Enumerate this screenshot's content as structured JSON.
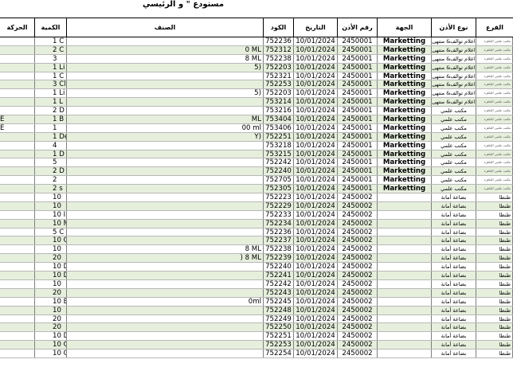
{
  "title": "مستودع \" و الرئيسي",
  "headers": {
    "branch": "الفرع",
    "perm_type": "نوع الأذن",
    "entity": "الجهة",
    "perm_no": "رقم الأذن",
    "date": "التاريخ",
    "code": "الكود",
    "item": "الصنف",
    "qty": "الكمية",
    "movement": "الحركة"
  },
  "rows": [
    {
      "branch": "مكتب علمي القاهرة",
      "ptype": "اعلام توالف& منتهى",
      "entity": "Marketting",
      "no": "2450001",
      "date": "10/01/2024",
      "code": "752236",
      "item": "",
      "qty": "1",
      "qtyx": "C",
      "mv": ""
    },
    {
      "branch": "مكتب علمي القاهرة",
      "ptype": "اعلام توالف& منتهى",
      "entity": "Marketting",
      "no": "2450001",
      "date": "10/01/2024",
      "code": "752312",
      "item": "0 ML",
      "qty": "2",
      "qtyx": "C",
      "mv": ""
    },
    {
      "branch": "مكتب علمي القاهرة",
      "ptype": "اعلام توالف& منتهى",
      "entity": "Marketting",
      "no": "2450001",
      "date": "10/01/2024",
      "code": "752238",
      "item": "8 ML",
      "qty": "3",
      "qtyx": "",
      "mv": ""
    },
    {
      "branch": "مكتب علمي القاهرة",
      "ptype": "اعلام توالف& منتهى",
      "entity": "Marketting",
      "no": "2450001",
      "date": "10/01/2024",
      "code": "752203",
      "item": "5)",
      "qty": "1",
      "qtyx": "Li",
      "mv": ""
    },
    {
      "branch": "مكتب علمي القاهرة",
      "ptype": "اعلام توالف& منتهى",
      "entity": "Marketting",
      "no": "2450001",
      "date": "10/01/2024",
      "code": "752321",
      "item": "",
      "qty": "1",
      "qtyx": "C",
      "mv": ""
    },
    {
      "branch": "مكتب علمي القاهرة",
      "ptype": "اعلام توالف& منتهى",
      "entity": "Marketting",
      "no": "2450001",
      "date": "10/01/2024",
      "code": "752253",
      "item": "",
      "qty": "3",
      "qtyx": "Cle",
      "mv": ""
    },
    {
      "branch": "مكتب علمي القاهرة",
      "ptype": "اعلام توالف& منتهى",
      "entity": "Marketting",
      "no": "2450001",
      "date": "10/01/2024",
      "code": "752203",
      "item": "5)",
      "qty": "1",
      "qtyx": "Li",
      "mv": ""
    },
    {
      "branch": "مكتب علمي القاهرة",
      "ptype": "اعلام توالف& منتهى",
      "entity": "Marketting",
      "no": "2450001",
      "date": "10/01/2024",
      "code": "753214",
      "item": "",
      "qty": "1",
      "qtyx": "L",
      "mv": ""
    },
    {
      "branch": "مكتب علمي القاهرة",
      "ptype": "مكتب علمي",
      "entity": "Marketting",
      "no": "2450001",
      "date": "10/01/2024",
      "code": "753216",
      "item": "",
      "qty": "2",
      "qtyx": "D",
      "mv": ""
    },
    {
      "branch": "مكتب علمي القاهرة",
      "ptype": "مكتب علمي",
      "entity": "Marketting",
      "no": "2450001",
      "date": "10/01/2024",
      "code": "753404",
      "item": "ML",
      "qty": "1",
      "qtyx": "B",
      "mv": "E"
    },
    {
      "branch": "مكتب علمي القاهرة",
      "ptype": "مكتب علمي",
      "entity": "Marketting",
      "no": "2450001",
      "date": "10/01/2024",
      "code": "753406",
      "item": "00 ml",
      "qty": "1",
      "qtyx": "",
      "mv": "E"
    },
    {
      "branch": "مكتب علمي القاهرة",
      "ptype": "مكتب علمي",
      "entity": "Marketting",
      "no": "2450001",
      "date": "10/01/2024",
      "code": "752251",
      "item": "Y)",
      "qty": "1",
      "qtyx": "De",
      "mv": ""
    },
    {
      "branch": "مكتب علمي القاهرة",
      "ptype": "مكتب علمي",
      "entity": "Marketting",
      "no": "2450001",
      "date": "10/01/2024",
      "code": "753218",
      "item": "",
      "qty": "4",
      "qtyx": "",
      "mv": ""
    },
    {
      "branch": "مكتب علمي القاهرة",
      "ptype": "مكتب علمي",
      "entity": "Marketting",
      "no": "2450001",
      "date": "10/01/2024",
      "code": "753215",
      "item": "",
      "qty": "1",
      "qtyx": "D",
      "mv": ""
    },
    {
      "branch": "مكتب علمي القاهرة",
      "ptype": "مكتب علمي",
      "entity": "Marketting",
      "no": "2450001",
      "date": "10/01/2024",
      "code": "752242",
      "item": "",
      "qty": "5",
      "qtyx": "",
      "mv": ""
    },
    {
      "branch": "مكتب علمي القاهرة",
      "ptype": "مكتب علمي",
      "entity": "Marketting",
      "no": "2450001",
      "date": "10/01/2024",
      "code": "752240",
      "item": "",
      "qty": "2",
      "qtyx": "D",
      "mv": ""
    },
    {
      "branch": "مكتب علمي القاهرة",
      "ptype": "مكتب علمي",
      "entity": "Marketting",
      "no": "2450001",
      "date": "10/01/2024",
      "code": "752705",
      "item": "",
      "qty": "2",
      "qtyx": "",
      "mv": ""
    },
    {
      "branch": "مكتب علمي القاهرة",
      "ptype": "مكتب علمي",
      "entity": "Marketting",
      "no": "2450001",
      "date": "10/01/2024",
      "code": "752305",
      "item": "",
      "qty": "2",
      "qtyx": "s",
      "mv": ""
    },
    {
      "branch": "طنطا",
      "ptype": "بضاعة أمانة",
      "entity": "",
      "no": "2450002",
      "date": "10/01/2024",
      "code": "752223",
      "item": "",
      "qty": "10",
      "qtyx": "",
      "mv": ""
    },
    {
      "branch": "طنطا",
      "ptype": "بضاعة أمانة",
      "entity": "",
      "no": "2450002",
      "date": "10/01/2024",
      "code": "752229",
      "item": "",
      "qty": "10",
      "qtyx": "",
      "mv": ""
    },
    {
      "branch": "طنطا",
      "ptype": "بضاعة أمانة",
      "entity": "",
      "no": "2450002",
      "date": "10/01/2024",
      "code": "752233",
      "item": "",
      "qty": "10",
      "qtyx": "I",
      "mv": ""
    },
    {
      "branch": "طنطا",
      "ptype": "بضاعة أمانة",
      "entity": "",
      "no": "2450002",
      "date": "10/01/2024",
      "code": "752234",
      "item": "",
      "qty": "10",
      "qtyx": "M",
      "mv": ""
    },
    {
      "branch": "طنطا",
      "ptype": "بضاعة أمانة",
      "entity": "",
      "no": "2450002",
      "date": "10/01/2024",
      "code": "752236",
      "item": "",
      "qty": "5",
      "qtyx": "C",
      "mv": ""
    },
    {
      "branch": "طنطا",
      "ptype": "بضاعة أمانة",
      "entity": "",
      "no": "2450002",
      "date": "10/01/2024",
      "code": "752237",
      "item": "",
      "qty": "10",
      "qtyx": "C",
      "mv": ""
    },
    {
      "branch": "طنطا",
      "ptype": "بضاعة أمانة",
      "entity": "",
      "no": "2450002",
      "date": "10/01/2024",
      "code": "752238",
      "item": "8 ML",
      "qty": "10",
      "qtyx": "",
      "mv": ""
    },
    {
      "branch": "طنطا",
      "ptype": "بضاعة أمانة",
      "entity": "",
      "no": "2450002",
      "date": "10/01/2024",
      "code": "752239",
      "item": ") 8 ML",
      "qty": "20",
      "qtyx": "",
      "mv": ""
    },
    {
      "branch": "طنطا",
      "ptype": "بضاعة أمانة",
      "entity": "",
      "no": "2450002",
      "date": "10/01/2024",
      "code": "752240",
      "item": "",
      "qty": "10",
      "qtyx": "D",
      "mv": ""
    },
    {
      "branch": "طنطا",
      "ptype": "بضاعة أمانة",
      "entity": "",
      "no": "2450002",
      "date": "10/01/2024",
      "code": "752241",
      "item": "",
      "qty": "10",
      "qtyx": "D",
      "mv": ""
    },
    {
      "branch": "طنطا",
      "ptype": "بضاعة أمانة",
      "entity": "",
      "no": "2450002",
      "date": "10/01/2024",
      "code": "752242",
      "item": "",
      "qty": "10",
      "qtyx": "",
      "mv": ""
    },
    {
      "branch": "طنطا",
      "ptype": "بضاعة أمانة",
      "entity": "",
      "no": "2450002",
      "date": "10/01/2024",
      "code": "752243",
      "item": "",
      "qty": "20",
      "qtyx": "",
      "mv": ""
    },
    {
      "branch": "طنطا",
      "ptype": "بضاعة أمانة",
      "entity": "",
      "no": "2450002",
      "date": "10/01/2024",
      "code": "752245",
      "item": "0ml",
      "qty": "10",
      "qtyx": "Bl",
      "mv": ""
    },
    {
      "branch": "طنطا",
      "ptype": "بضاعة أمانة",
      "entity": "",
      "no": "2450002",
      "date": "10/01/2024",
      "code": "752248",
      "item": "",
      "qty": "10",
      "qtyx": "",
      "mv": ""
    },
    {
      "branch": "طنطا",
      "ptype": "بضاعة أمانة",
      "entity": "",
      "no": "2450002",
      "date": "10/01/2024",
      "code": "752249",
      "item": "",
      "qty": "20",
      "qtyx": "",
      "mv": ""
    },
    {
      "branch": "طنطا",
      "ptype": "بضاعة أمانة",
      "entity": "",
      "no": "2450002",
      "date": "10/01/2024",
      "code": "752250",
      "item": "",
      "qty": "20",
      "qtyx": "",
      "mv": ""
    },
    {
      "branch": "طنطا",
      "ptype": "بضاعة أمانة",
      "entity": "",
      "no": "2450002",
      "date": "10/01/2024",
      "code": "752251",
      "item": "",
      "qty": "10",
      "qtyx": "De",
      "mv": ""
    },
    {
      "branch": "طنطا",
      "ptype": "بضاعة أمانة",
      "entity": "",
      "no": "2450002",
      "date": "10/01/2024",
      "code": "752253",
      "item": "",
      "qty": "10",
      "qtyx": "Cle",
      "mv": ""
    },
    {
      "branch": "طنطا",
      "ptype": "بضاعة أمانة",
      "entity": "",
      "no": "2450002",
      "date": "10/01/2024",
      "code": "752254",
      "item": "",
      "qty": "10",
      "qtyx": "Cle",
      "mv": ""
    }
  ]
}
